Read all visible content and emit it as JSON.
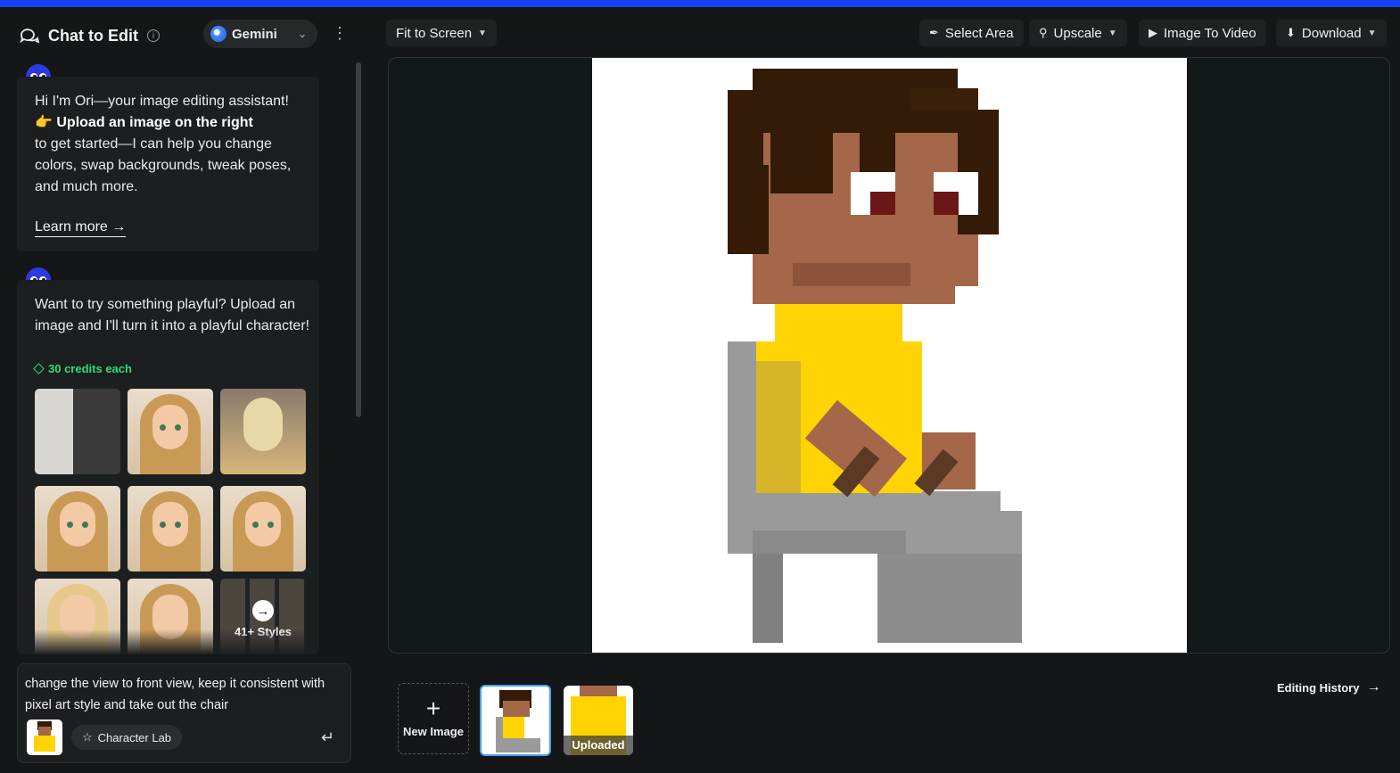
{
  "header": {
    "title": "Chat to Edit",
    "model": "Gemini"
  },
  "messages": [
    {
      "line1": "Hi I'm Ori—your image editing assistant!",
      "bold": "Upload an image on the right",
      "line2": "to get started—I can help you change colors, swap backgrounds, tweak poses, and much more.",
      "link": "Learn more"
    },
    {
      "text": "Want to try something playful? Upload an image and I'll turn it into a playful character!",
      "credits": "30 credits each",
      "more_styles": "41+ Styles"
    }
  ],
  "composer": {
    "input_text": "change the view to front view, keep it consistent with pixel art style and take out the chair",
    "character_lab": "Character Lab"
  },
  "toolbar": {
    "fit": "Fit to Screen",
    "select_area": "Select Area",
    "upscale": "Upscale",
    "image_to_video": "Image To Video",
    "download": "Download"
  },
  "history": {
    "new_image": "New Image",
    "uploaded": "Uploaded",
    "editing_history": "Editing History"
  },
  "colors": {
    "accent_bar": "#1740f0",
    "credits_green": "#2ddc7a",
    "active_thumb": "#3da0ff",
    "hair": "#331b07",
    "skin": "#a4674a",
    "shirt": "#ffd402",
    "chair": "#9a9a9a"
  }
}
